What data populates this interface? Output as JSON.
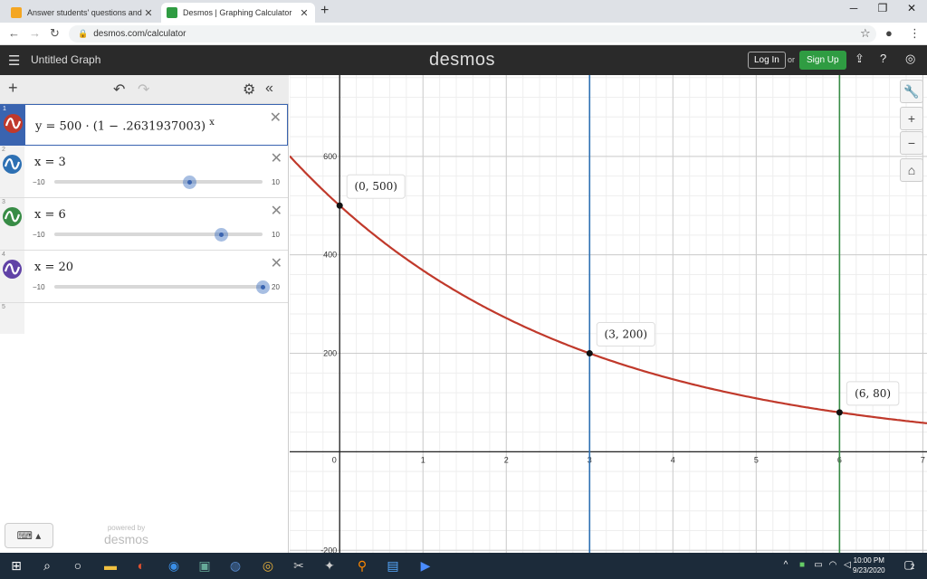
{
  "browser": {
    "tabs": [
      {
        "title": "Answer students' questions and e",
        "active": false,
        "favicon_color": "#f4a622"
      },
      {
        "title": "Desmos | Graphing Calculator",
        "active": true,
        "favicon_color": "#2f9c42"
      }
    ],
    "url": "desmos.com/calculator"
  },
  "header": {
    "graph_title": "Untitled Graph",
    "logo": "desmos",
    "login_label": "Log In",
    "or_label": "or",
    "signup_label": "Sign Up",
    "accent": "#2f9c42"
  },
  "expressions": [
    {
      "index": "1",
      "latex": "y = 500 · (1 − .2631937003) ",
      "exp": "x",
      "color": "#c0392b"
    },
    {
      "index": "2",
      "latex": "x = 3",
      "color": "#2d70b3",
      "slider_min": "−10",
      "slider_max": "10",
      "value": 3
    },
    {
      "index": "3",
      "latex": "x = 6",
      "color": "#388c46",
      "slider_min": "−10",
      "slider_max": "10",
      "value": 6
    },
    {
      "index": "4",
      "latex": "x = 20",
      "color": "#6042a6",
      "slider_min": "−10",
      "slider_max": "20",
      "value": 20
    },
    {
      "index": "5"
    }
  ],
  "powered_by": {
    "line1": "powered by",
    "line2": "desmos"
  },
  "graph": {
    "x_ticks": [
      "0",
      "1",
      "2",
      "3",
      "4",
      "5",
      "6",
      "7"
    ],
    "y_ticks": [
      "600",
      "400",
      "200",
      "-200"
    ],
    "x_range": [
      -0.6,
      7.05
    ],
    "y_range": [
      -205,
      765
    ],
    "curve": {
      "a": 500,
      "b": 0.7368062997,
      "color": "#c0392b"
    },
    "vlines": [
      {
        "x": 3,
        "color": "#2d70b3"
      },
      {
        "x": 6,
        "color": "#388c46"
      }
    ],
    "points": [
      {
        "x": 0,
        "y": 500,
        "label": "(0, 500)"
      },
      {
        "x": 3,
        "y": 200,
        "label": "(3, 200)"
      },
      {
        "x": 6,
        "y": 80,
        "label": "(6, 80)"
      }
    ]
  },
  "taskbar": {
    "time": "10:00 PM",
    "date": "9/23/2020",
    "notif_count": "2"
  }
}
